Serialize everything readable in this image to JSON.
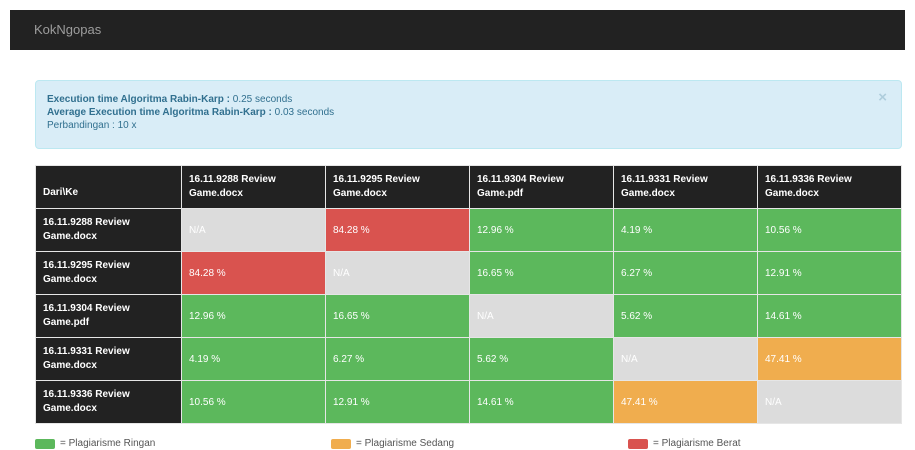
{
  "navbar": {
    "brand": "KokNgopas"
  },
  "alert": {
    "line1_label": "Execution time Algoritma Rabin-Karp :",
    "line1_value": "0.25 seconds",
    "line2_label": "Average Execution time Algoritma Rabin-Karp :",
    "line2_value": "0.03 seconds",
    "line3_label": "Perbandingan :",
    "line3_value": "10 x",
    "close": "×"
  },
  "table": {
    "corner": "Dari\\Ke",
    "columns": [
      "16.11.9288 Review Game.docx",
      "16.11.9295 Review Game.docx",
      "16.11.9304 Review Game.pdf",
      "16.11.9331 Review Game.docx",
      "16.11.9336 Review Game.docx"
    ],
    "rows": [
      {
        "label": "16.11.9288 Review Game.docx",
        "cells": [
          {
            "text": "N/A",
            "status": "na"
          },
          {
            "text": "84.28 %",
            "status": "red"
          },
          {
            "text": "12.96 %",
            "status": "green"
          },
          {
            "text": "4.19 %",
            "status": "green"
          },
          {
            "text": "10.56 %",
            "status": "green"
          }
        ]
      },
      {
        "label": "16.11.9295 Review Game.docx",
        "cells": [
          {
            "text": "84.28 %",
            "status": "red"
          },
          {
            "text": "N/A",
            "status": "na"
          },
          {
            "text": "16.65 %",
            "status": "green"
          },
          {
            "text": "6.27 %",
            "status": "green"
          },
          {
            "text": "12.91 %",
            "status": "green"
          }
        ]
      },
      {
        "label": "16.11.9304 Review Game.pdf",
        "cells": [
          {
            "text": "12.96 %",
            "status": "green"
          },
          {
            "text": "16.65 %",
            "status": "green"
          },
          {
            "text": "N/A",
            "status": "na"
          },
          {
            "text": "5.62 %",
            "status": "green"
          },
          {
            "text": "14.61 %",
            "status": "green"
          }
        ]
      },
      {
        "label": "16.11.9331 Review Game.docx",
        "cells": [
          {
            "text": "4.19 %",
            "status": "green"
          },
          {
            "text": "6.27 %",
            "status": "green"
          },
          {
            "text": "5.62 %",
            "status": "green"
          },
          {
            "text": "N/A",
            "status": "na"
          },
          {
            "text": "47.41 %",
            "status": "orange"
          }
        ]
      },
      {
        "label": "16.11.9336 Review Game.docx",
        "cells": [
          {
            "text": "10.56 %",
            "status": "green"
          },
          {
            "text": "12.91 %",
            "status": "green"
          },
          {
            "text": "14.61 %",
            "status": "green"
          },
          {
            "text": "47.41 %",
            "status": "orange"
          },
          {
            "text": "N/A",
            "status": "na"
          }
        ]
      }
    ]
  },
  "legend": [
    {
      "label": "= Plagiarisme Ringan",
      "color": "#5cb85c"
    },
    {
      "label": "= Plagiarisme Sedang",
      "color": "#f0ad4e"
    },
    {
      "label": "= Plagiarisme Berat",
      "color": "#d9534f"
    }
  ],
  "colors": {
    "navbar": "#222222",
    "alert_bg": "#d9edf7",
    "green": "#5cb85c",
    "orange": "#f0ad4e",
    "red": "#d9534f",
    "na": "#dcdcdc"
  }
}
